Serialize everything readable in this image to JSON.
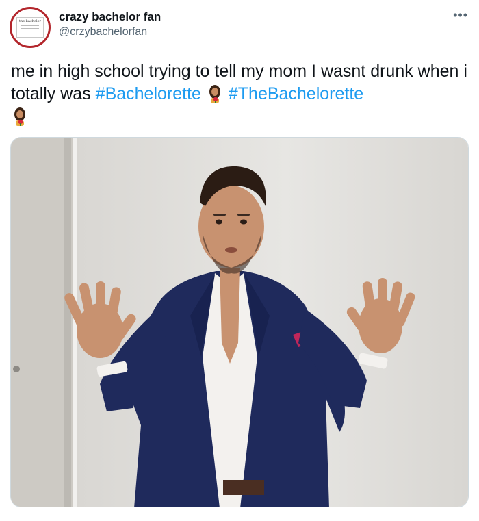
{
  "user": {
    "display_name": "crazy bachelor fan",
    "handle": "@crzybachelorfan",
    "avatar_logo_text": "the bachelor"
  },
  "tweet": {
    "text_before": "me in high school trying to tell my mom I wasnt drunk when i totally was ",
    "hashtags": [
      "#Bachelorette",
      "#TheBachelorette"
    ],
    "emoji": "woman-with-rose-emoji"
  },
  "media": {
    "description_icon": "photo"
  },
  "more_icon": "ellipsis-icon",
  "colors": {
    "link": "#1d9bf0",
    "secondary_text": "#536471",
    "avatar_ring": "#b3262c",
    "blazer": "#1f2a5c"
  }
}
